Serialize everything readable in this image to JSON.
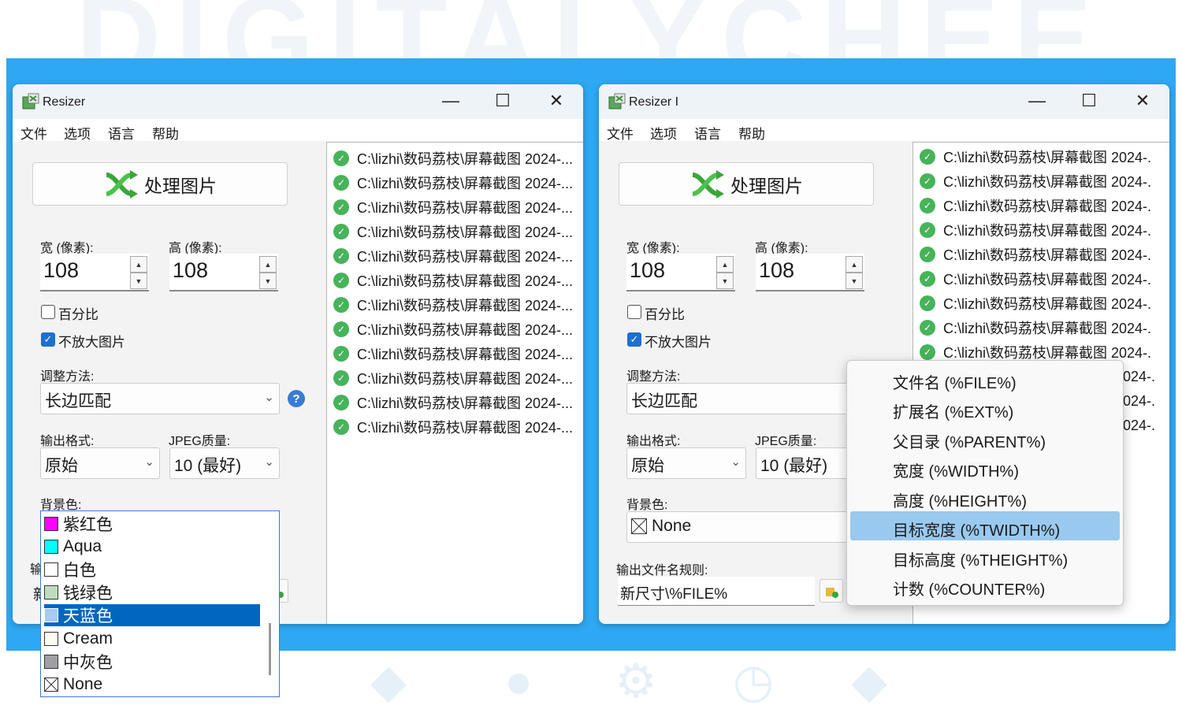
{
  "watermark": "DIGITALYCHEE",
  "left_window": {
    "title": "Resizer",
    "menus": [
      "文件",
      "选项",
      "语言",
      "帮助"
    ],
    "process_button": "处理图片",
    "width_label": "宽 (像素):",
    "height_label": "高 (像素):",
    "width_value": "108",
    "height_value": "108",
    "percent_label": "百分比",
    "percent_checked": false,
    "no_enlarge_label": "不放大图片",
    "no_enlarge_checked": true,
    "method_label": "调整方法:",
    "method_value": "长边匹配",
    "format_label": "输出格式:",
    "format_value": "原始",
    "jpeg_label": "JPEG质量:",
    "jpeg_value": "10 (最好)",
    "bg_label": "背景色:",
    "out_label_partial": "输",
    "out_value_partial": "新",
    "bg_options": [
      {
        "label": "紫红色",
        "color": "#ff00ff",
        "selected": false
      },
      {
        "label": "Aqua",
        "color": "#00ffff",
        "selected": false
      },
      {
        "label": "白色",
        "color": "#ffffff",
        "selected": false
      },
      {
        "label": "钱绿色",
        "color": "#c0dcc0",
        "selected": false
      },
      {
        "label": "天蓝色",
        "color": "#a6caf0",
        "selected": true
      },
      {
        "label": "Cream",
        "color": "#fffbf0",
        "selected": false
      },
      {
        "label": "中灰色",
        "color": "#a0a0a4",
        "selected": false
      },
      {
        "label": "None",
        "color": "none",
        "selected": false
      }
    ],
    "files": [
      "C:\\lizhi\\数码荔枝\\屏幕截图 2024-...",
      "C:\\lizhi\\数码荔枝\\屏幕截图 2024-...",
      "C:\\lizhi\\数码荔枝\\屏幕截图 2024-...",
      "C:\\lizhi\\数码荔枝\\屏幕截图 2024-...",
      "C:\\lizhi\\数码荔枝\\屏幕截图 2024-...",
      "C:\\lizhi\\数码荔枝\\屏幕截图 2024-...",
      "C:\\lizhi\\数码荔枝\\屏幕截图 2024-...",
      "C:\\lizhi\\数码荔枝\\屏幕截图 2024-...",
      "C:\\lizhi\\数码荔枝\\屏幕截图 2024-...",
      "C:\\lizhi\\数码荔枝\\屏幕截图 2024-...",
      "C:\\lizhi\\数码荔枝\\屏幕截图 2024-...",
      "C:\\lizhi\\数码荔枝\\屏幕截图 2024-..."
    ]
  },
  "right_window": {
    "title": "Resizer I",
    "menus": [
      "文件",
      "选项",
      "语言",
      "帮助"
    ],
    "process_button": "处理图片",
    "width_label": "宽 (像素):",
    "height_label": "高 (像素):",
    "width_value": "108",
    "height_value": "108",
    "percent_label": "百分比",
    "no_enlarge_label": "不放大图片",
    "method_label": "调整方法:",
    "method_value": "长边匹配",
    "format_label": "输出格式:",
    "format_value": "原始",
    "jpeg_label": "JPEG质量:",
    "jpeg_value": "10 (最好)",
    "bg_label": "背景色:",
    "bg_value": "None",
    "rule_label": "输出文件名规则:",
    "rule_value": "新尺寸\\%FILE%",
    "files": [
      "C:\\lizhi\\数码荔枝\\屏幕截图 2024-.",
      "C:\\lizhi\\数码荔枝\\屏幕截图 2024-.",
      "C:\\lizhi\\数码荔枝\\屏幕截图 2024-.",
      "C:\\lizhi\\数码荔枝\\屏幕截图 2024-.",
      "C:\\lizhi\\数码荔枝\\屏幕截图 2024-.",
      "C:\\lizhi\\数码荔枝\\屏幕截图 2024-.",
      "C:\\lizhi\\数码荔枝\\屏幕截图 2024-.",
      "C:\\lizhi\\数码荔枝\\屏幕截图 2024-.",
      "C:\\lizhi\\数码荔枝\\屏幕截图 2024-."
    ],
    "files_partial": [
      "2024-.",
      "2024-.",
      "2024-."
    ],
    "token_menu": [
      {
        "label": "文件名 (%FILE%)",
        "selected": false
      },
      {
        "label": "扩展名 (%EXT%)",
        "selected": false
      },
      {
        "label": "父目录 (%PARENT%)",
        "selected": false
      },
      {
        "label": "宽度 (%WIDTH%)",
        "selected": false
      },
      {
        "label": "高度 (%HEIGHT%)",
        "selected": false
      },
      {
        "label": "目标宽度 (%TWIDTH%)",
        "selected": true
      },
      {
        "label": "目标高度 (%THEIGHT%)",
        "selected": false
      },
      {
        "label": "计数 (%COUNTER%)",
        "selected": false
      }
    ]
  },
  "colors": {
    "band": "#2ea8f2",
    "selection": "#0067c0",
    "menu_highlight": "#99c9ef",
    "success": "#47b35a"
  }
}
